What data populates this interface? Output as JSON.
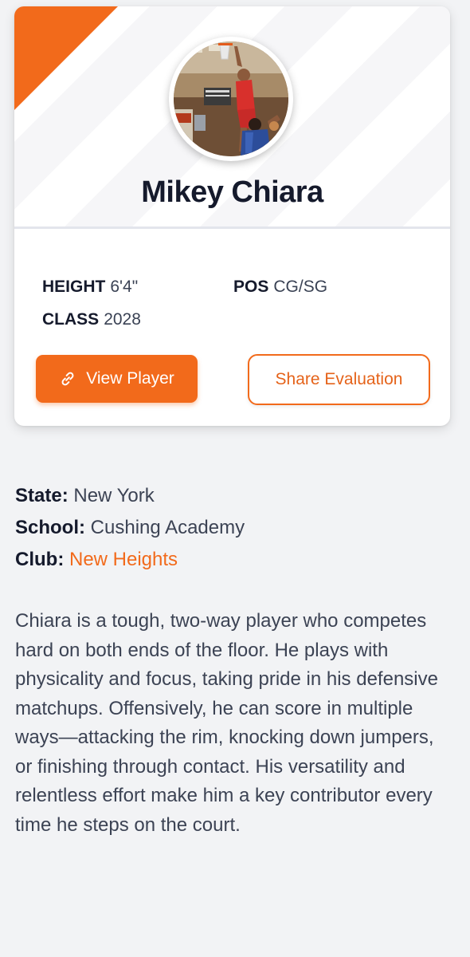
{
  "player": {
    "name": "Mikey Chiara",
    "photo_alt": "Player dunking in gym"
  },
  "stats": {
    "height_label": "HEIGHT",
    "height_value": "6'4\"",
    "pos_label": "POS",
    "pos_value": "CG/SG",
    "class_label": "CLASS",
    "class_value": "2028"
  },
  "actions": {
    "view_player": "View Player",
    "share_evaluation": "Share Evaluation"
  },
  "details": {
    "state_label": "State:",
    "state_value": "New York",
    "school_label": "School:",
    "school_value": "Cushing Academy",
    "club_label": "Club:",
    "club_value": "New Heights"
  },
  "bio": "Chiara is a tough, two-way player who competes hard on both ends of the floor. He plays with physicality and focus, taking pride in his defensive matchups. Offensively, he can score in multiple ways—attacking the rim, knocking down jumpers, or finishing through contact. His versatility and relentless effort make him a key contributor every time he steps on the court.",
  "colors": {
    "accent": "#f26a1b",
    "text_dark": "#151a2c",
    "text_body": "#3c4354",
    "background": "#f2f3f5"
  },
  "icons": {
    "view_player": "link-icon"
  }
}
